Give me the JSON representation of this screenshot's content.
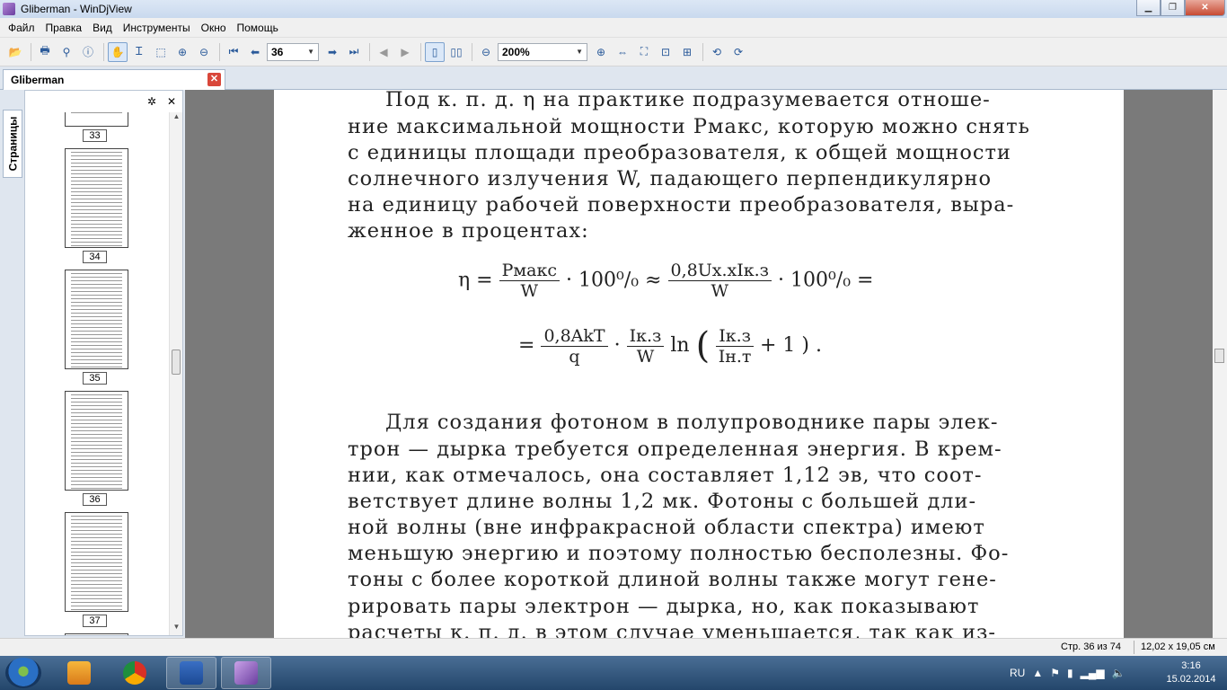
{
  "window": {
    "title": "Gliberman - WinDjView"
  },
  "titlebar_buttons": {
    "minimize": "▁",
    "maximize": "❐",
    "close": "✕"
  },
  "menu": [
    "Файл",
    "Правка",
    "Вид",
    "Инструменты",
    "Окно",
    "Помощь"
  ],
  "toolbar": {
    "page_number": "36",
    "zoom": "200%"
  },
  "tab": {
    "label": "Gliberman",
    "close": "✕"
  },
  "sidebar": {
    "tab_label": "Страницы",
    "settings_icon": "✲",
    "close_icon": "✕",
    "thumbnails": [
      "33",
      "34",
      "35",
      "36",
      "37"
    ]
  },
  "document": {
    "lines_top": [
      "Под к. п. д. η на практике подразумевается отноше-",
      "ние максимальной мощности Pмакс, которую можно снять",
      "с единицы площади преобразователя, к общей мощности",
      "солнечного излучения W, падающего перпендикулярно",
      "на единицу рабочей поверхности преобразователя, выра-",
      "женное в процентах:"
    ],
    "formula1": {
      "lhs": "η =",
      "f1_num": "Pмакс",
      "f1_den": "W",
      "mid": "· 100⁰/₀ ≈",
      "f2_num": "0,8Uх.хIк.з",
      "f2_den": "W",
      "end": "· 100⁰/₀ ="
    },
    "formula2": {
      "lead": "=",
      "f1_num": "0,8AkT",
      "f1_den": "q",
      "dot": "·",
      "f2_num": "Iк.з",
      "f2_den": "W",
      "ln": "ln",
      "f3_num": "Iк.з",
      "f3_den": "Iн.т",
      "tail": "+ 1 ) ."
    },
    "lines_bottom": [
      "Для создания фотоном в полупроводнике пары элек-",
      "трон — дырка требуется определенная энергия. В крем-",
      "нии, как отмечалось, она составляет 1,12 эв, что соот-",
      "ветствует длине волны 1,2 мк. Фотоны с большей дли-",
      "ной волны (вне инфракрасной области спектра) имеют",
      "меньшую энергию и поэтому полностью бесполезны. Фо-",
      "тоны с более короткой длиной волны также могут гене-",
      "рировать пары электрон — дырка, но, как показывают",
      "расчеты к. п. д. в этом случае уменьшается, так как из-"
    ]
  },
  "status": {
    "page": "Стр. 36 из 74",
    "size": "12,02 x 19,05 см"
  },
  "taskbar": {
    "tray_lang": "RU",
    "time": "3:16",
    "date": "15.02.2014"
  },
  "colors": {
    "accent": "#2a5a9a",
    "taskbar": "#2f5580",
    "doc_background": "#7a7a7a"
  }
}
